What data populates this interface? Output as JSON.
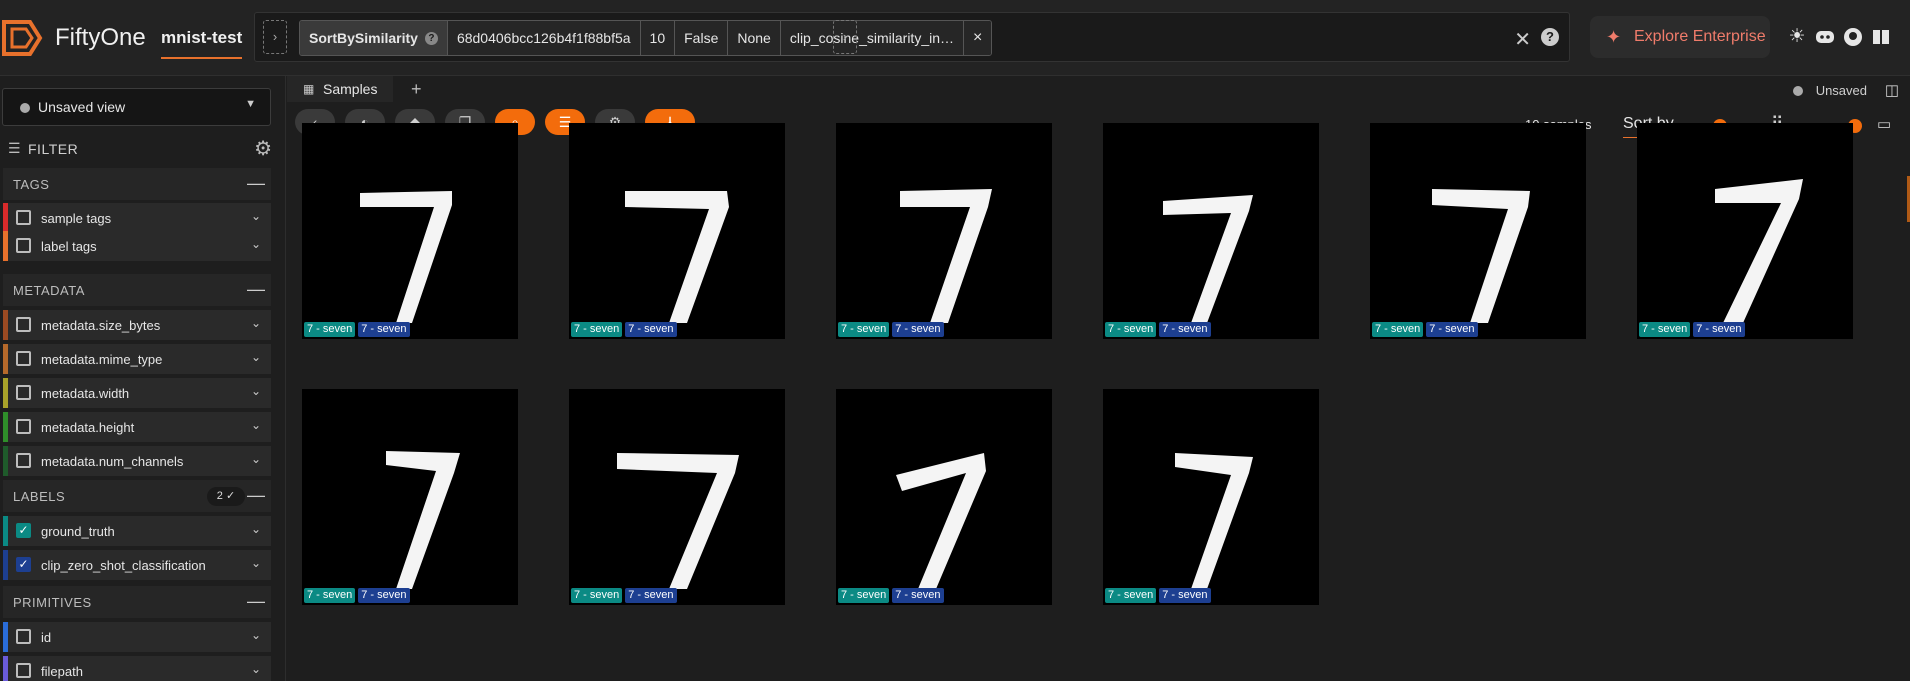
{
  "app": {
    "brand": "FiftyOne",
    "dataset": "mnist-test"
  },
  "view_bar": {
    "stage_name": "SortBySimilarity",
    "params": [
      "68d0406bcc126b4f1f88bf5a",
      "10",
      "False",
      "None",
      "clip_cosine_similarity_in…"
    ],
    "close": "×",
    "help": "?"
  },
  "header": {
    "enterprise_label": "Explore Enterprise"
  },
  "sidebar": {
    "view_select": "Unsaved view",
    "filter_label": "FILTER",
    "sections": [
      {
        "label": "TAGS"
      },
      {
        "label": "METADATA"
      },
      {
        "label": "LABELS",
        "badge": "2 ✓"
      },
      {
        "label": "PRIMITIVES"
      }
    ],
    "fields": [
      {
        "label": "sample tags",
        "color": "#d92b2b",
        "checked": false
      },
      {
        "label": "label tags",
        "color": "#e8712c",
        "checked": false
      },
      {
        "label": "metadata.size_bytes",
        "color": "#9b4a22",
        "checked": false
      },
      {
        "label": "metadata.mime_type",
        "color": "#b5692b",
        "checked": false
      },
      {
        "label": "metadata.width",
        "color": "#a8a22a",
        "checked": false
      },
      {
        "label": "metadata.height",
        "color": "#2f8e2a",
        "checked": false
      },
      {
        "label": "metadata.num_channels",
        "color": "#1f5b2b",
        "checked": false
      },
      {
        "label": "ground_truth",
        "color": "#0b8a84",
        "checked": true
      },
      {
        "label": "clip_zero_shot_classification",
        "color": "#1d3f91",
        "checked": true
      },
      {
        "label": "id",
        "color": "#2a6cd9",
        "checked": false
      },
      {
        "label": "filepath",
        "color": "#6a5bd9",
        "checked": false
      }
    ]
  },
  "main": {
    "tab": "Samples",
    "tab_add": "+",
    "unsaved": "Unsaved",
    "sample_count": "10 samples",
    "sort_by": "Sort by",
    "grid_zoom_fraction": 0.9,
    "tiles": [
      {
        "gt": "7 - seven",
        "clip": "7 - seven"
      },
      {
        "gt": "7 - seven",
        "clip": "7 - seven"
      },
      {
        "gt": "7 - seven",
        "clip": "7 - seven"
      },
      {
        "gt": "7 - seven",
        "clip": "7 - seven"
      },
      {
        "gt": "7 - seven",
        "clip": "7 - seven"
      },
      {
        "gt": "7 - seven",
        "clip": "7 - seven"
      },
      {
        "gt": "7 - seven",
        "clip": "7 - seven"
      },
      {
        "gt": "7 - seven",
        "clip": "7 - seven"
      },
      {
        "gt": "7 - seven",
        "clip": "7 - seven"
      },
      {
        "gt": "7 - seven",
        "clip": "7 - seven"
      }
    ]
  },
  "colors": {
    "accent": "#f36c0c",
    "ground_truth": "#0b8a84",
    "clip": "#1d3f91"
  }
}
